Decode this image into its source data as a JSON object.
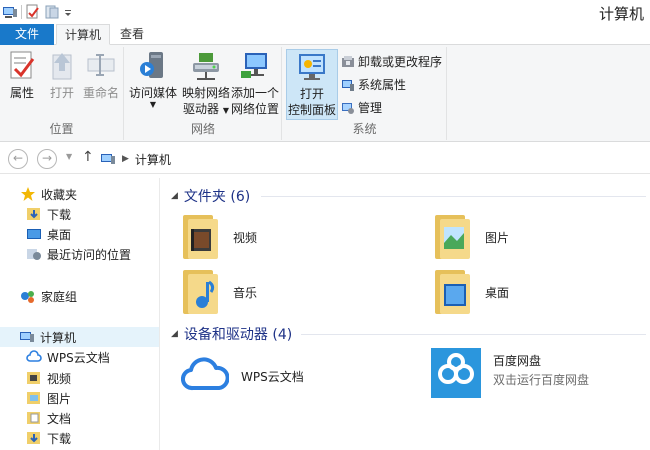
{
  "window": {
    "title": "计算机"
  },
  "tabs": {
    "file": "文件",
    "computer": "计算机",
    "view": "查看"
  },
  "ribbon": {
    "location": {
      "label": "位置",
      "properties": "属性",
      "open": "打开",
      "rename": "重命名"
    },
    "network": {
      "label": "网络",
      "access_media_l1": "访问媒体",
      "map_drive_l1": "映射网络",
      "map_drive_l2": "驱动器",
      "add_location_l1": "添加一个",
      "add_location_l2": "网络位置"
    },
    "system": {
      "label": "系统",
      "open_cp_l1": "打开",
      "open_cp_l2": "控制面板",
      "uninstall": "卸载或更改程序",
      "sys_props": "系统属性",
      "manage": "管理"
    }
  },
  "address": {
    "crumb": "计算机"
  },
  "nav": {
    "favorites": "收藏夹",
    "downloads": "下载",
    "desktop": "桌面",
    "recent": "最近访问的位置",
    "homegroup": "家庭组",
    "computer": "计算机",
    "wps": "WPS云文档",
    "videos": "视频",
    "pictures": "图片",
    "documents": "文档",
    "downloads2": "下载"
  },
  "content": {
    "folders_header": "文件夹 (6)",
    "devices_header": "设备和驱动器 (4)",
    "folders": {
      "videos": "视频",
      "pictures": "图片",
      "music": "音乐",
      "desktop": "桌面"
    },
    "devices": {
      "wps": "WPS云文档",
      "baidu_name": "百度网盘",
      "baidu_sub": "双击运行百度网盘"
    }
  },
  "colors": {
    "file_tab": "#1979ca",
    "header_text": "#1e3287",
    "folder": "#f3d98a",
    "wps_blue": "#2c7fe0",
    "baidu_bg": "#2b96dd"
  }
}
